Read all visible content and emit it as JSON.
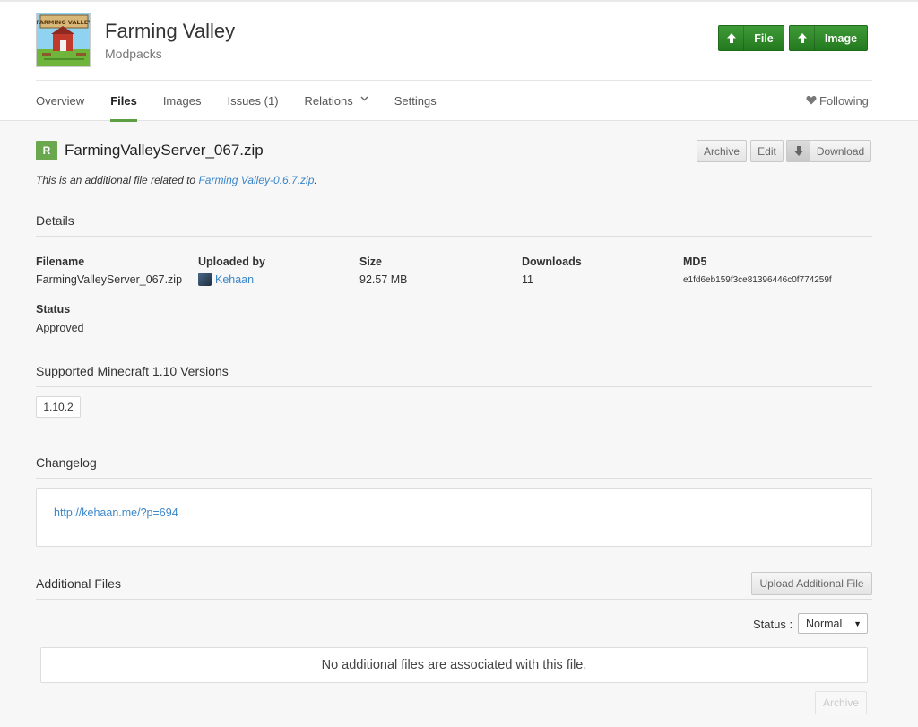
{
  "project": {
    "title": "Farming Valley",
    "category": "Modpacks",
    "thumb_text": "FARMING VALLEY"
  },
  "header_buttons": {
    "file": "File",
    "image": "Image"
  },
  "tabs": [
    {
      "label": "Overview"
    },
    {
      "label": "Files",
      "active": true
    },
    {
      "label": "Images"
    },
    {
      "label": "Issues (1)"
    },
    {
      "label": "Relations"
    },
    {
      "label": "Settings"
    }
  ],
  "following": "Following",
  "file": {
    "badge": "R",
    "name": "FarmingValleyServer_067.zip",
    "related_prefix": "This is an additional file related to ",
    "related_link": "Farming Valley-0.6.7.zip",
    "related_suffix": ".",
    "actions": {
      "archive": "Archive",
      "edit": "Edit",
      "download": "Download"
    }
  },
  "details": {
    "section_title": "Details",
    "filename_label": "Filename",
    "filename": "FarmingValleyServer_067.zip",
    "uploaded_by_label": "Uploaded by",
    "uploaded_by": "Kehaan",
    "size_label": "Size",
    "size": "92.57 MB",
    "downloads_label": "Downloads",
    "downloads": "11",
    "md5_label": "MD5",
    "md5": "e1fd6eb159f3ce81396446c0f774259f",
    "status_label": "Status",
    "status": "Approved"
  },
  "versions": {
    "section_title": "Supported Minecraft 1.10 Versions",
    "items": [
      "1.10.2"
    ]
  },
  "changelog": {
    "section_title": "Changelog",
    "link": "http://kehaan.me/?p=694"
  },
  "additional_files": {
    "section_title": "Additional Files",
    "upload_button": "Upload Additional File",
    "status_label": "Status :",
    "status_value": "Normal",
    "empty_message": "No additional files are associated with this file.",
    "archive_button": "Archive"
  },
  "colors": {
    "accent_green": "#5b9f42",
    "button_green": "#2f8a29",
    "link_blue": "#3b86c9"
  }
}
